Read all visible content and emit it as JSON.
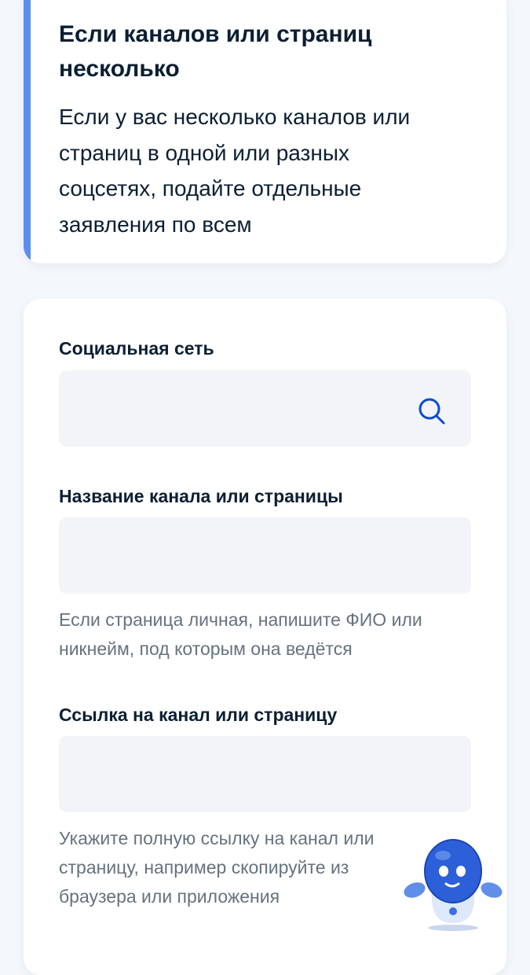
{
  "info": {
    "title": "Если каналов или страниц несколько",
    "text": "Если у вас несколько каналов или страниц в одной или разных соцсетях, подайте отдельные заявления по всем"
  },
  "form": {
    "social_network": {
      "label": "Социальная сеть",
      "value": "",
      "icon": "search-icon"
    },
    "channel_name": {
      "label": "Название канала или страницы",
      "value": "",
      "hint": "Если страница личная, напишите ФИО или никнейм, под которым она ведётся"
    },
    "channel_link": {
      "label": "Ссылка на канал или страницу",
      "value": "",
      "hint": "Укажите полную ссылку на канал или страницу, например скопируйте из браузера или приложения"
    }
  },
  "assistant": {
    "icon": "robot-assistant-icon"
  },
  "colors": {
    "accent": "#5a8dee",
    "background": "#f4f7fc",
    "input_background": "#f2f4f8",
    "text": "#0b1f33",
    "hint_text": "#66727f",
    "icon": "#0d4cd3"
  }
}
